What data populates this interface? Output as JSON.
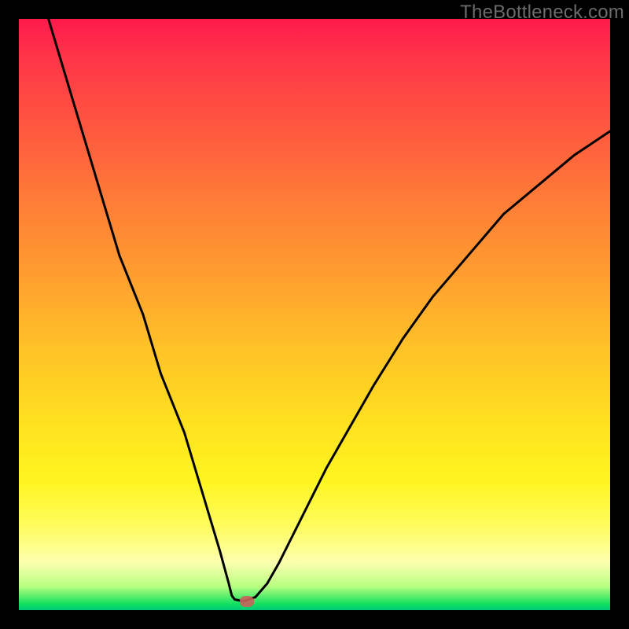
{
  "watermark": "TheBottleneck.com",
  "colors": {
    "background": "#000000",
    "curve": "#000000",
    "marker": "#c9635b"
  },
  "chart_data": {
    "type": "line",
    "title": "",
    "xlabel": "",
    "ylabel": "",
    "curve_points": [
      {
        "x": 0.05,
        "y": 0.0
      },
      {
        "x": 0.08,
        "y": 0.1
      },
      {
        "x": 0.11,
        "y": 0.2
      },
      {
        "x": 0.14,
        "y": 0.3
      },
      {
        "x": 0.17,
        "y": 0.4
      },
      {
        "x": 0.21,
        "y": 0.5
      },
      {
        "x": 0.24,
        "y": 0.6
      },
      {
        "x": 0.28,
        "y": 0.7
      },
      {
        "x": 0.31,
        "y": 0.8
      },
      {
        "x": 0.34,
        "y": 0.9
      },
      {
        "x": 0.355,
        "y": 0.955
      },
      {
        "x": 0.36,
        "y": 0.975
      },
      {
        "x": 0.365,
        "y": 0.982
      },
      {
        "x": 0.38,
        "y": 0.985
      },
      {
        "x": 0.4,
        "y": 0.978
      },
      {
        "x": 0.42,
        "y": 0.955
      },
      {
        "x": 0.44,
        "y": 0.92
      },
      {
        "x": 0.46,
        "y": 0.88
      },
      {
        "x": 0.49,
        "y": 0.82
      },
      {
        "x": 0.52,
        "y": 0.76
      },
      {
        "x": 0.56,
        "y": 0.69
      },
      {
        "x": 0.6,
        "y": 0.62
      },
      {
        "x": 0.65,
        "y": 0.54
      },
      {
        "x": 0.7,
        "y": 0.47
      },
      {
        "x": 0.76,
        "y": 0.4
      },
      {
        "x": 0.82,
        "y": 0.33
      },
      {
        "x": 0.88,
        "y": 0.28
      },
      {
        "x": 0.94,
        "y": 0.23
      },
      {
        "x": 1.0,
        "y": 0.19
      }
    ],
    "marker": {
      "x": 0.385,
      "y": 0.985
    },
    "ylim": [
      0,
      1
    ],
    "xlim": [
      0,
      1
    ]
  }
}
